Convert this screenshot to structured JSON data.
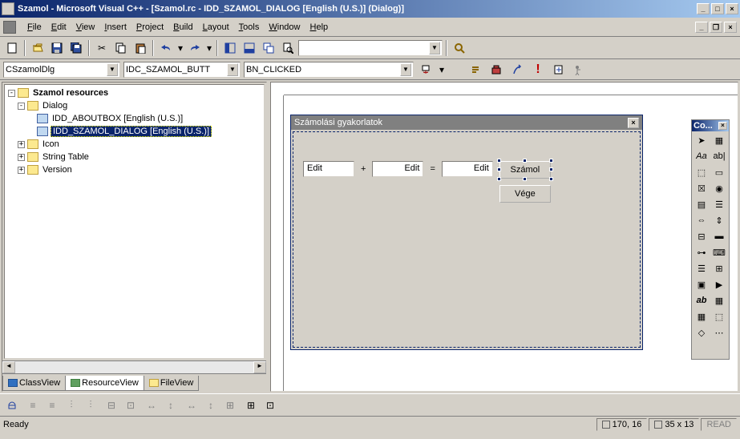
{
  "titlebar": {
    "text": "Szamol - Microsoft Visual C++ - [Szamol.rc - IDD_SZAMOL_DIALOG [English (U.S.)] (Dialog)]"
  },
  "menu": {
    "file": "File",
    "edit": "Edit",
    "view": "View",
    "insert": "Insert",
    "project": "Project",
    "build": "Build",
    "layout": "Layout",
    "tools": "Tools",
    "window": "Window",
    "help": "Help"
  },
  "combos": {
    "class": "CSzamolDlg",
    "control": "IDC_SZAMOL_BUTT",
    "message": "BN_CLICKED",
    "find": ""
  },
  "tree": {
    "root": "Szamol resources",
    "dialog": "Dialog",
    "aboutbox": "IDD_ABOUTBOX [English (U.S.)]",
    "szamoldlg": "IDD_SZAMOL_DIALOG [English (U.S.)]",
    "icon": "Icon",
    "stringtable": "String Table",
    "version": "Version"
  },
  "tabs": {
    "class": "ClassView",
    "resource": "ResourceView",
    "file": "FileView"
  },
  "dialog": {
    "title": "Számolási gyakorlatok",
    "edit1": "Edit",
    "plus": "+",
    "edit2": "Edit",
    "equals": "=",
    "edit3": "Edit",
    "btn_calc": "Számol",
    "btn_end": "Vége"
  },
  "toolbox": {
    "title": "Co..."
  },
  "status": {
    "ready": "Ready",
    "pos": "170, 16",
    "size": "35 x 13",
    "read": "READ"
  }
}
